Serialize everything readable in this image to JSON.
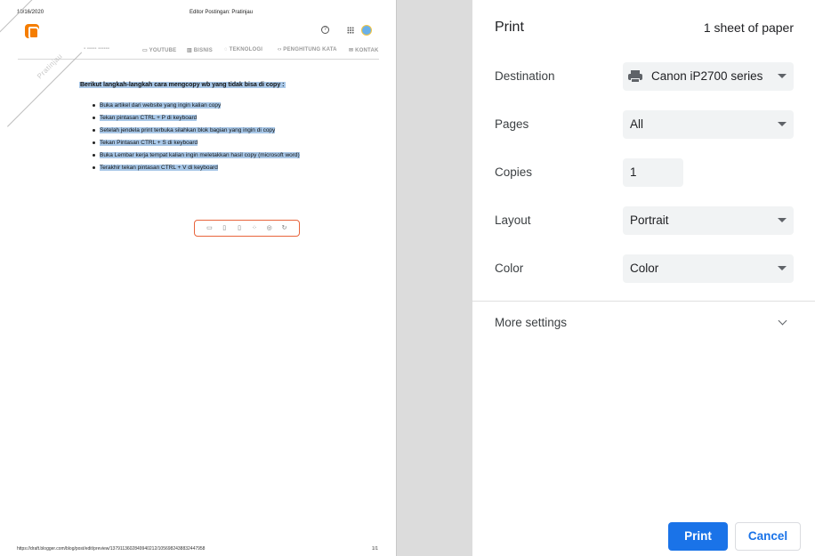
{
  "preview": {
    "header_date": "10/16/2020",
    "header_title": "Editor Postingan: Pratinjau",
    "nav": [
      "YOUTUBE",
      "BISNIS",
      "TEKNOLOGI",
      "PENGHITUNG KATA",
      "KONTAK"
    ],
    "watermark": "Pratinjau",
    "intro": "Berikut langkah-langkah cara mengcopy wb yang tidak bisa di copy :",
    "steps": [
      "Buka artikel dari website yang ingin kalian copy",
      "Tekan pintasan CTRL + P  di keyboard",
      "Setelah jendela print terbuka silahkan blok bagian yang ingin di copy",
      "Tekan Pintasan CTRL + S  di keyboard",
      "Buka Lembar kerja tempat kalian ingin meletakkan hasil copy (microsoft word)",
      "Terakhir tekan pintasan CTRL + V di keyboard"
    ],
    "footer_url": "https://draft.blogger.com/blog/post/edit/preview/1379113602849940212/1056982438832447958",
    "footer_page": "1/1"
  },
  "panel": {
    "title": "Print",
    "sheets": "1 sheet of paper",
    "destination_label": "Destination",
    "destination_value": "Canon iP2700 series",
    "pages_label": "Pages",
    "pages_value": "All",
    "copies_label": "Copies",
    "copies_value": "1",
    "layout_label": "Layout",
    "layout_value": "Portrait",
    "color_label": "Color",
    "color_value": "Color",
    "more_settings": "More settings",
    "print_button": "Print",
    "cancel_button": "Cancel"
  },
  "colors": {
    "accent": "#1a73e8",
    "highlight": "#a9c8e8",
    "blogger": "#f57d00"
  }
}
